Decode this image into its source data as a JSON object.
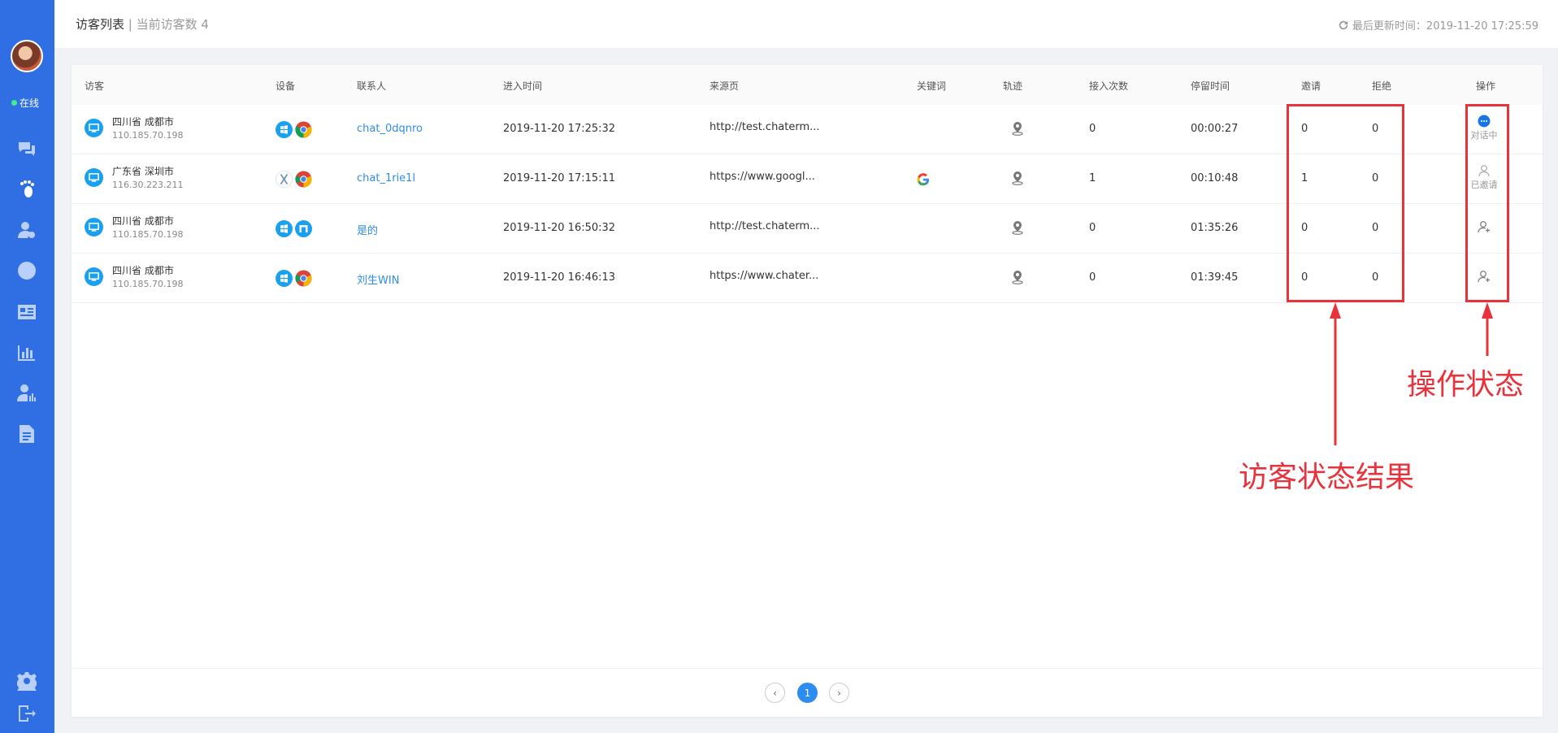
{
  "sidebar": {
    "status": "在线",
    "nav_icons": [
      "chat-bubbles-icon",
      "footprint-icon",
      "users-icon",
      "clock-icon",
      "id-card-icon",
      "bar-chart-icon",
      "user-chart-icon",
      "document-icon"
    ],
    "bottom_icons": [
      "gear-icon",
      "logout-icon"
    ],
    "accent_color": "#2f6fe3"
  },
  "header": {
    "title": "访客列表",
    "separator": "|",
    "subtitle": "当前访客数 4",
    "updated": "最后更新时间：2019-11-20 17:25:59"
  },
  "table": {
    "columns": [
      "访客",
      "设备",
      "联系人",
      "进入时间",
      "来源页",
      "关键词",
      "轨迹",
      "接入次数",
      "停留时间",
      "邀请",
      "拒绝",
      "操作"
    ],
    "rows": [
      {
        "location": "四川省 成都市",
        "ip": "110.185.70.198",
        "os": "windows-icon",
        "browser": "chrome-icon",
        "contact": "chat_0dqnro",
        "enter_time": "2019-11-20 17:25:32",
        "source": "http://test.chaterm...",
        "keyword": "",
        "visits": "0",
        "stay": "00:00:27",
        "invite": "0",
        "reject": "0",
        "op_icon": "chat-icon",
        "op_label": "对话中"
      },
      {
        "location": "广东省 深圳市",
        "ip": "116.30.223.211",
        "os": "macos-x-icon",
        "browser": "chrome-icon",
        "contact": "chat_1rie1l",
        "enter_time": "2019-11-20 17:15:11",
        "source": "https://www.googl...",
        "keyword": "google-icon",
        "visits": "1",
        "stay": "00:10:48",
        "invite": "1",
        "reject": "0",
        "op_icon": "user-icon",
        "op_label": "已邀请"
      },
      {
        "location": "四川省 成都市",
        "ip": "110.185.70.198",
        "os": "windows-icon",
        "browser": "maxthon-icon",
        "contact": "是的",
        "enter_time": "2019-11-20 16:50:32",
        "source": "http://test.chaterm...",
        "keyword": "",
        "visits": "0",
        "stay": "01:35:26",
        "invite": "0",
        "reject": "0",
        "op_icon": "add-user-icon",
        "op_label": ""
      },
      {
        "location": "四川省 成都市",
        "ip": "110.185.70.198",
        "os": "windows-icon",
        "browser": "chrome-icon",
        "contact": "刘生WIN",
        "enter_time": "2019-11-20 16:46:13",
        "source": "https://www.chater...",
        "keyword": "",
        "visits": "0",
        "stay": "01:39:45",
        "invite": "0",
        "reject": "0",
        "op_icon": "add-user-icon",
        "op_label": ""
      }
    ]
  },
  "pagination": {
    "current": "1",
    "prev": "‹",
    "next": "›"
  },
  "annotations": {
    "visitor_status": "访客状态结果",
    "op_status": "操作状态",
    "color": "#e8323c"
  }
}
